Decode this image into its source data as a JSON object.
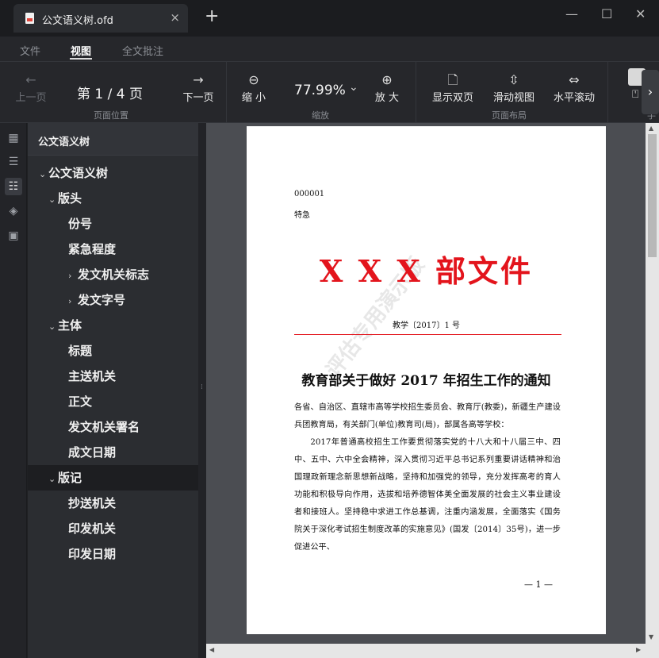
{
  "window": {
    "tab_title": "公文语义树.ofd",
    "tab_close": "×",
    "new_tab": "+",
    "minimize": "—",
    "maximize": "☐",
    "close": "✕"
  },
  "menu": {
    "items": [
      "文件",
      "视图",
      "全文批注"
    ],
    "active": "视图"
  },
  "toolbar": {
    "prev_page": "上一页",
    "page_indicator": "第 1 / 4 页",
    "next_page": "下一页",
    "page_position_group": "页面位置",
    "zoom_out": "缩 小",
    "zoom_value": "77.99%",
    "zoom_in": "放 大",
    "zoom_group": "缩放",
    "double_page": "显示双页",
    "scroll_view": "滑动视图",
    "horizontal_scroll": "水平滚动",
    "layout_group": "页面布局",
    "more_group": "手"
  },
  "panel": {
    "title": "公文语义树",
    "tree": [
      {
        "label": "公文语义树",
        "level": 0,
        "chevron": "⌄"
      },
      {
        "label": "版头",
        "level": 1,
        "chevron": "⌄"
      },
      {
        "label": "份号",
        "level": 2,
        "chevron": ""
      },
      {
        "label": "紧急程度",
        "level": 2,
        "chevron": ""
      },
      {
        "label": "发文机关标志",
        "level": 2,
        "chevron": "›"
      },
      {
        "label": "发文字号",
        "level": 2,
        "chevron": "›"
      },
      {
        "label": "主体",
        "level": 1,
        "chevron": "⌄"
      },
      {
        "label": "标题",
        "level": 2,
        "chevron": ""
      },
      {
        "label": "主送机关",
        "level": 2,
        "chevron": ""
      },
      {
        "label": "正文",
        "level": 2,
        "chevron": ""
      },
      {
        "label": "发文机关署名",
        "level": 2,
        "chevron": ""
      },
      {
        "label": "成文日期",
        "level": 2,
        "chevron": ""
      },
      {
        "label": "版记",
        "level": 1,
        "chevron": "⌄",
        "selected": true
      },
      {
        "label": "抄送机关",
        "level": 2,
        "chevron": ""
      },
      {
        "label": "印发机关",
        "level": 2,
        "chevron": ""
      },
      {
        "label": "印发日期",
        "level": 2,
        "chevron": ""
      }
    ]
  },
  "document": {
    "copy_number": "000001",
    "urgency": "特急",
    "header": "X X X 部文件",
    "doc_number": "教学〔2017〕1 号",
    "title": "教育部关于做好 2017 年招生工作的通知",
    "recipients": "各省、自治区、直辖市高等学校招生委员会、教育厅(教委)，新疆生产建设兵团教育局，有关部门(单位)教育司(局)，部属各高等学校：",
    "body": "2017年普通高校招生工作要贯彻落实党的十八大和十八届三中、四中、五中、六中全会精神，深入贯彻习近平总书记系列重要讲话精神和治国理政新理念新思想新战略，坚持和加强党的领导，充分发挥高考的育人功能和积极导向作用，选拔和培养德智体美全面发展的社会主义事业建设者和接班人。坚持稳中求进工作总基调，注重内涵发展，全面落实《国务院关于深化考试招生制度改革的实施意见》(国发〔2014〕35号)，进一步促进公平、",
    "page_number": "— 1 —",
    "watermark": "评估专用演示版"
  }
}
